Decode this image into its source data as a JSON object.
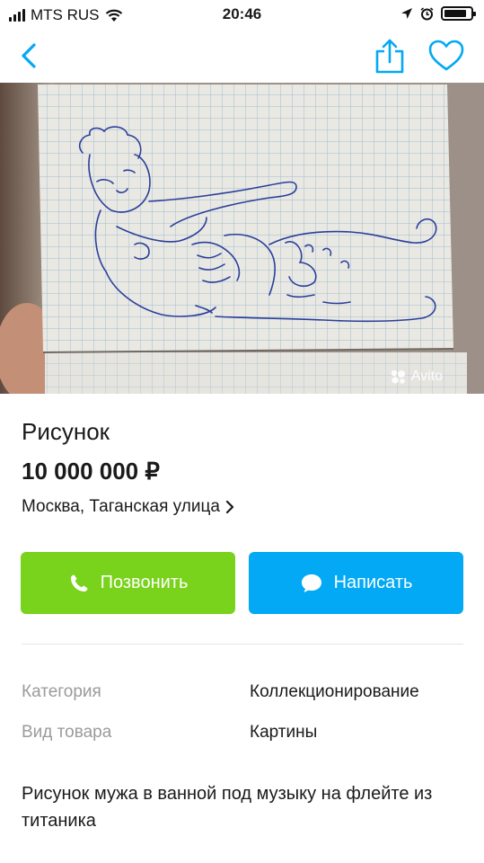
{
  "status_bar": {
    "carrier": "MTS RUS",
    "time": "20:46"
  },
  "nav": {
    "back_icon": "chevron-left-icon",
    "share_icon": "share-icon",
    "favorite_icon": "heart-icon",
    "accent_color": "#03a9f4"
  },
  "listing": {
    "photo_watermark": "Avito",
    "title": "Рисунок",
    "price": "10 000 000 ₽",
    "address": "Москва, Таганская улица"
  },
  "actions": {
    "call_label": "Позвонить",
    "call_color": "#79d21b",
    "message_label": "Написать",
    "message_color": "#03a9f4"
  },
  "properties": [
    {
      "label": "Категория",
      "value": "Коллекционирование"
    },
    {
      "label": "Вид товара",
      "value": "Картины"
    }
  ],
  "description": "Рисунок мужа в ванной под музыку на флейте из титаника"
}
